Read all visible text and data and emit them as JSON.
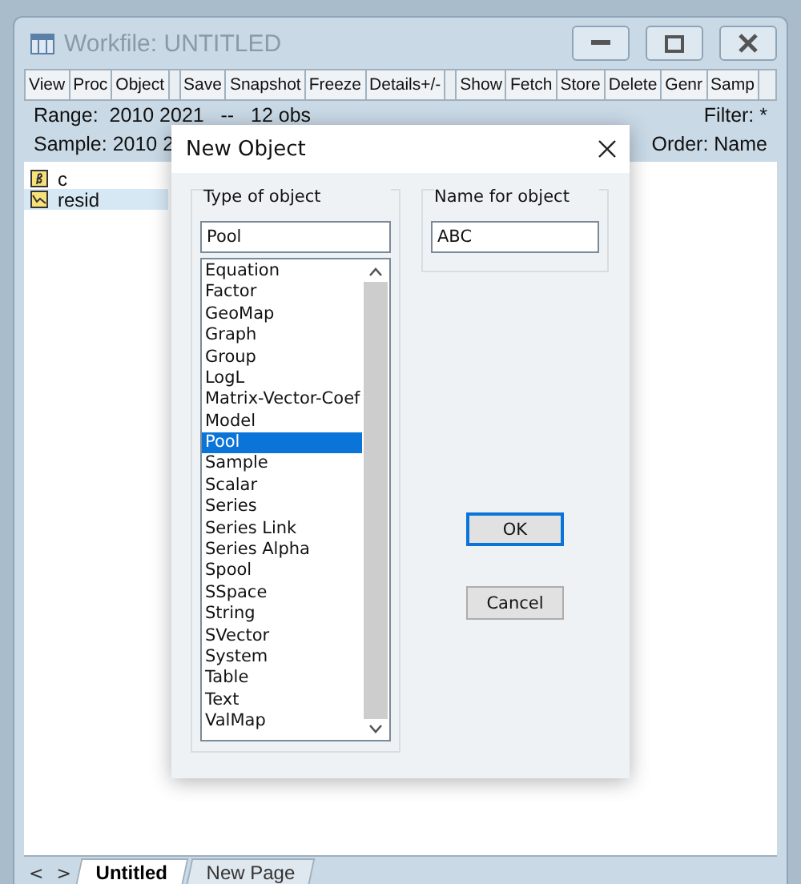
{
  "window": {
    "title": "Workfile: UNTITLED"
  },
  "toolbar": [
    [
      "View",
      "Proc",
      "Object"
    ],
    [
      "Save",
      "Snapshot",
      "Freeze",
      "Details+/-"
    ],
    [
      "Show",
      "Fetch",
      "Store",
      "Delete",
      "Genr",
      "Samp"
    ]
  ],
  "info": {
    "range": "Range:  2010 2021   --   12 obs",
    "filter": "Filter: *",
    "sample": "Sample: 2010 2",
    "order": "Order: Name"
  },
  "objects": [
    {
      "name": "c",
      "kind": "coef",
      "selected": false
    },
    {
      "name": "resid",
      "kind": "series",
      "selected": true
    }
  ],
  "dialog": {
    "title": "New Object",
    "type_label": "Type of object",
    "type_value": "Pool",
    "name_label": "Name for object",
    "name_value": "ABC",
    "types": [
      {
        "label": "Equation",
        "selected": false
      },
      {
        "label": "Factor",
        "selected": false
      },
      {
        "label": "GeoMap",
        "selected": false
      },
      {
        "label": "Graph",
        "selected": false
      },
      {
        "label": "Group",
        "selected": false
      },
      {
        "label": "LogL",
        "selected": false
      },
      {
        "label": "Matrix-Vector-Coef",
        "selected": false
      },
      {
        "label": "Model",
        "selected": false
      },
      {
        "label": "Pool",
        "selected": true
      },
      {
        "label": "Sample",
        "selected": false
      },
      {
        "label": "Scalar",
        "selected": false
      },
      {
        "label": "Series",
        "selected": false
      },
      {
        "label": "Series Link",
        "selected": false
      },
      {
        "label": "Series Alpha",
        "selected": false
      },
      {
        "label": "Spool",
        "selected": false
      },
      {
        "label": "SSpace",
        "selected": false
      },
      {
        "label": "String",
        "selected": false
      },
      {
        "label": "SVector",
        "selected": false
      },
      {
        "label": "System",
        "selected": false
      },
      {
        "label": "Table",
        "selected": false
      },
      {
        "label": "Text",
        "selected": false
      },
      {
        "label": "ValMap",
        "selected": false
      }
    ],
    "buttons": [
      {
        "label": "OK",
        "default": true
      },
      {
        "label": "Cancel",
        "default": false
      }
    ]
  },
  "page_nav": [
    "<",
    ">"
  ],
  "pages": [
    {
      "label": "Untitled",
      "selected": true
    },
    {
      "label": "New Page",
      "selected": false
    }
  ]
}
